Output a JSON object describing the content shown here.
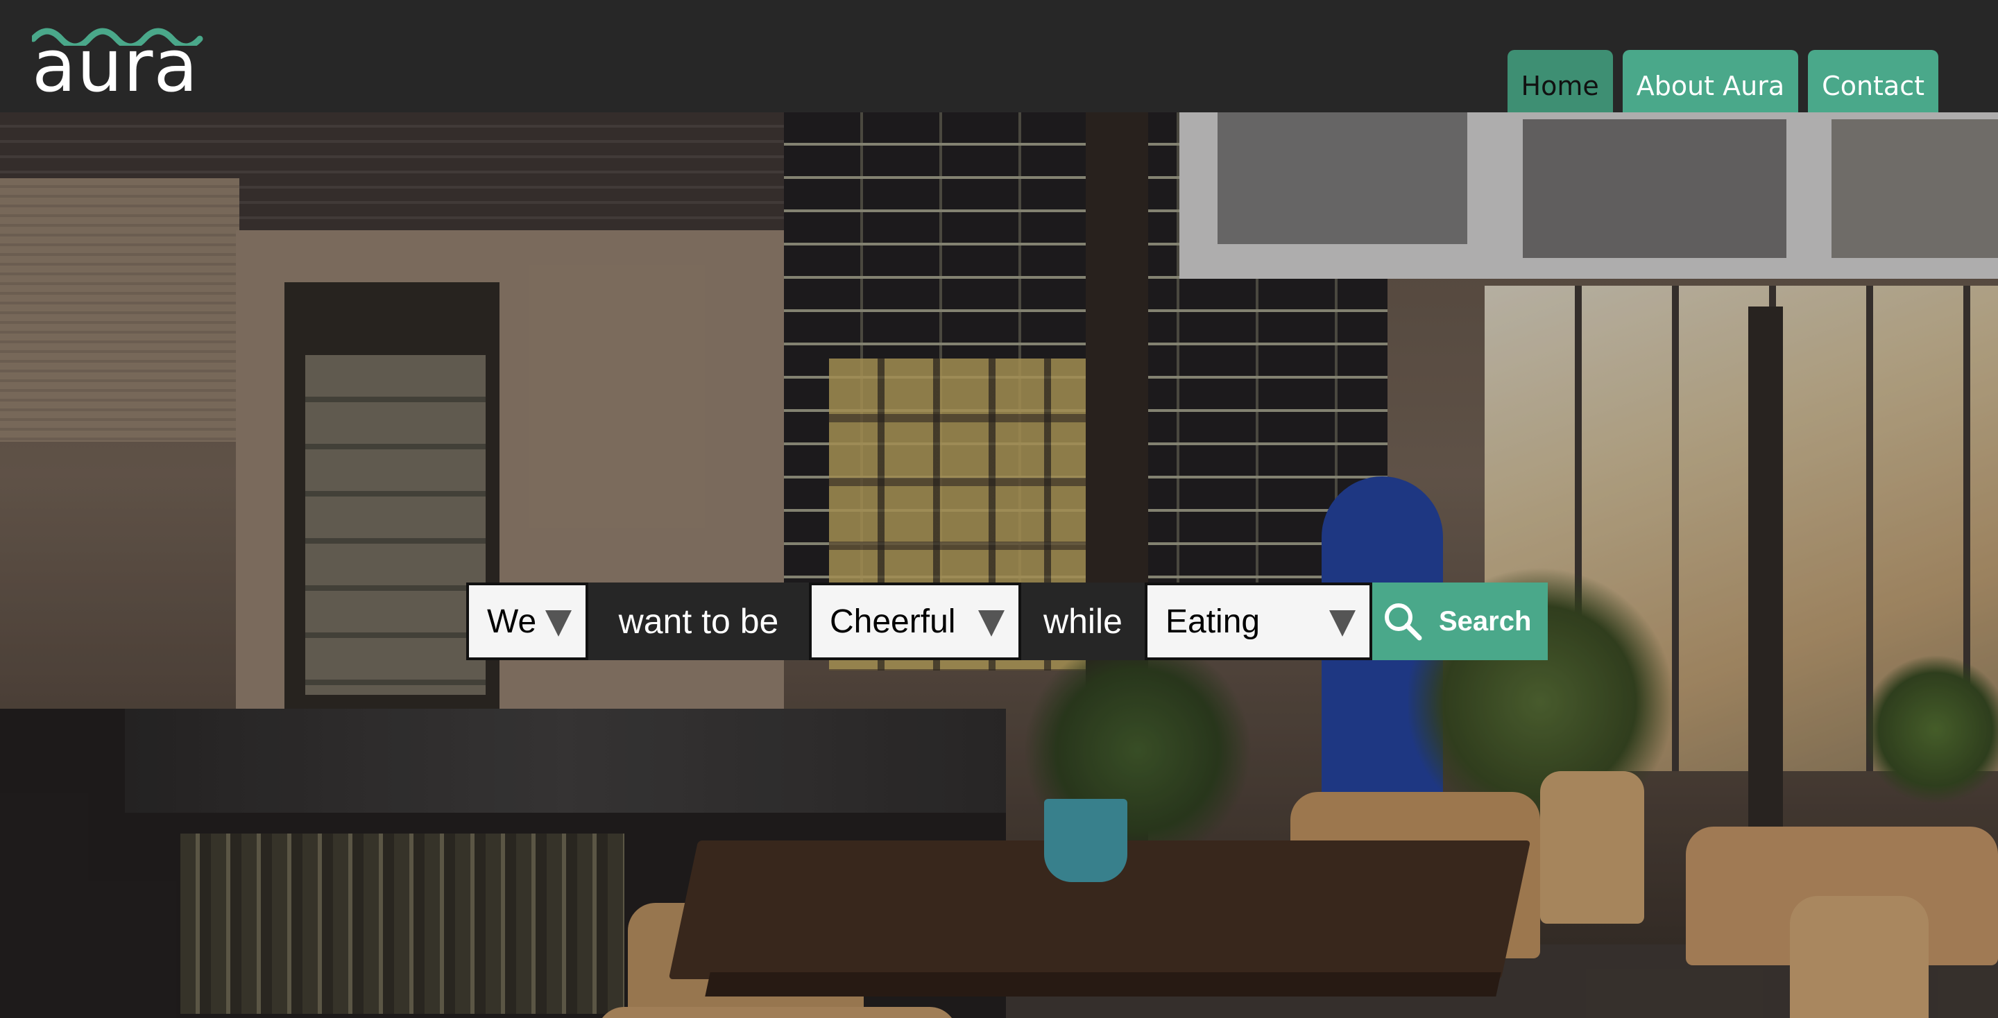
{
  "brand": {
    "name": "aura",
    "accent": "#4aa88a"
  },
  "nav": {
    "items": [
      {
        "label": "Home",
        "active": true
      },
      {
        "label": "About Aura",
        "active": false
      },
      {
        "label": "Contact",
        "active": false
      }
    ]
  },
  "search": {
    "subject": {
      "value": "We"
    },
    "joiner1": "want to be",
    "mood": {
      "value": "Cheerful"
    },
    "joiner2": "while",
    "activity": {
      "value": "Eating"
    },
    "button_label": "Search",
    "button_icon": "search-icon"
  },
  "colors": {
    "topbar": "#272727",
    "nav_tab": "#4aa88a",
    "nav_tab_active": "#3e8f73"
  }
}
